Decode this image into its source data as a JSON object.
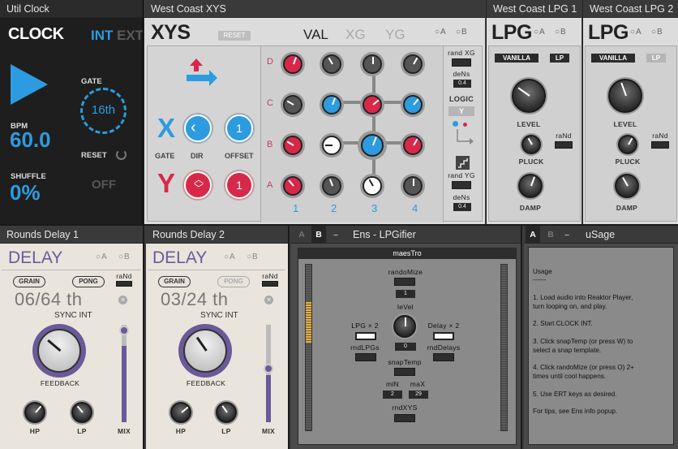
{
  "clock": {
    "header": "Util Clock",
    "title": "CLOCK",
    "int": "INT",
    "ext": "EXT",
    "gate_label": "GATE",
    "gate_value": "16th",
    "bpm_label": "BPM",
    "bpm_value": "60.0",
    "reset_label": "RESET",
    "shuffle_label": "SHUFFLE",
    "shuffle_value": "0%",
    "off_label": "OFF"
  },
  "xys": {
    "header": "West Coast XYS",
    "title": "XYS",
    "reset": "RESET",
    "val": "VAL",
    "xg": "XG",
    "yg": "YG",
    "a": "A",
    "b": "B",
    "x": "X",
    "y": "Y",
    "gate": "GATE",
    "dir": "DIR",
    "offset": "OFFSET",
    "offset_x": "1",
    "offset_y": "1",
    "rows": [
      "D",
      "C",
      "B",
      "A"
    ],
    "cols": [
      "1",
      "2",
      "3",
      "4"
    ],
    "rand_xg": "rand XG",
    "dens1": "deNs",
    "dens1_val": "0.4",
    "logic": "LOGIC",
    "logic_val": "Y",
    "rand_yg": "rand YG",
    "dens2": "deNs",
    "dens2_val": "0.4"
  },
  "lpg1": {
    "header": "West Coast LPG 1",
    "title": "LPG",
    "a": "A",
    "b": "B",
    "vanilla": "VANILLA",
    "lp": "LP",
    "level": "LEVEL",
    "rand": "raNd",
    "pluck": "PLUCK",
    "damp": "DAMP"
  },
  "lpg2": {
    "header": "West Coast LPG 2",
    "title": "LPG",
    "a": "A",
    "b": "B",
    "vanilla": "VANILLA",
    "lp": "LP",
    "level": "LEVEL",
    "rand": "raNd",
    "pluck": "PLUCK",
    "damp": "DAMP"
  },
  "delay1": {
    "header": "Rounds Delay 1",
    "title": "DELAY",
    "a": "A",
    "b": "B",
    "grain": "GRAIN",
    "pong": "PONG",
    "rand": "raNd",
    "time": "06/64 th",
    "sync": "SYNC INT",
    "feedback": "FEEDBACK",
    "hp": "HP",
    "lp": "LP",
    "mix": "MIX",
    "mix_level": 0.78
  },
  "delay2": {
    "header": "Rounds Delay 2",
    "title": "DELAY",
    "a": "A",
    "b": "B",
    "grain": "GRAIN",
    "pong": "PONG",
    "rand": "raNd",
    "time": "03/24 th",
    "sync": "SYNC INT",
    "feedback": "FEEDBACK",
    "hp": "HP",
    "lp": "LP",
    "mix": "MIX",
    "mix_level": 0.55
  },
  "ens": {
    "a": "A",
    "b": "B",
    "minus": "–",
    "header": "Ens - LPGifier",
    "maestro": "maesTro",
    "randomize": "randoMize",
    "randomize_val": "1",
    "level": "leVel",
    "lpg2": "LPG × 2",
    "delay2": "Delay × 2",
    "rnd_lpgs": "rndLPGs",
    "level_val": "0",
    "rnd_delays": "rndDelays",
    "snaptemp": "snapTemp",
    "min": "miN",
    "max": "maX",
    "min_val": "2",
    "max_val": "29",
    "rndxys": "rndXYS",
    "meter_left": 0.45,
    "meter_right": 0.0
  },
  "usage": {
    "a": "A",
    "b": "B",
    "minus": "–",
    "header": "uSage",
    "lines": [
      "Usage",
      "------",
      "",
      "1. Load audio into Reaktor Player,",
      "turn looping on, and play.",
      "",
      "2. Start CLOCK INT.",
      "",
      "3. Click snapTemp (or press W) to",
      "select a snap template.",
      "",
      "4. Click randoMize (or press O) 2+",
      "times until cool happens.",
      "",
      "5. Use ERT keys as desired.",
      "",
      "For tips, see Ens info popup."
    ]
  },
  "colors": {
    "accent_blue": "#2d9be0",
    "accent_red": "#d8284a",
    "delay_purple": "#6a5a9a"
  }
}
